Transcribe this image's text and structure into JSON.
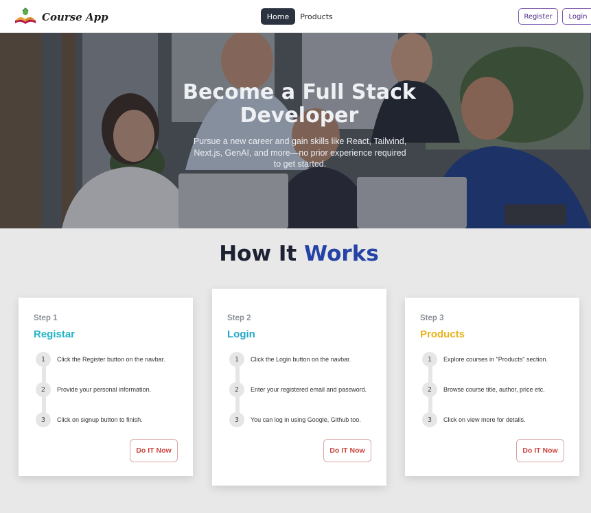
{
  "navbar": {
    "brand": "Course App",
    "links": {
      "home": "Home",
      "products": "Products"
    },
    "auth": {
      "register": "Register",
      "login": "Login"
    }
  },
  "hero": {
    "title": "Become a Full Stack Developer",
    "subtitle": "Pursue a new career and gain skills like React, Tailwind, Next.js, GenAI, and more—no prior experience required to get started."
  },
  "how_it_works": {
    "title_part1": "How It",
    "title_part2": "Works",
    "steps": [
      {
        "label": "Step 1",
        "title": "Registar",
        "items": [
          {
            "num": "1",
            "text": "Click the Register button on the navbar."
          },
          {
            "num": "2",
            "text": "Provide your personal information."
          },
          {
            "num": "3",
            "text": "Click on signup button to finish."
          }
        ],
        "button": "Do IT Now"
      },
      {
        "label": "Step 2",
        "title": "Login",
        "items": [
          {
            "num": "1",
            "text": "Click the Login button on the navbar."
          },
          {
            "num": "2",
            "text": "Enter your registered email and password."
          },
          {
            "num": "3",
            "text": "You can log in using Google, Github too."
          }
        ],
        "button": "Do IT Now"
      },
      {
        "label": "Step 3",
        "title": "Products",
        "items": [
          {
            "num": "1",
            "text": "Explore courses in \"Products\" section."
          },
          {
            "num": "2",
            "text": "Browse course title, author, price etc."
          },
          {
            "num": "3",
            "text": "Click on view more for details."
          }
        ],
        "button": "Do IT Now"
      }
    ]
  },
  "colors": {
    "nav_active_bg": "#2b3340",
    "accent_blue": "#2543a6",
    "step1_title": "#23b4c6",
    "step2_title": "#23a6c8",
    "step3_title": "#e8b21c",
    "cta_red": "#c9433f"
  },
  "icons": {
    "logo": "open-book-logo-icon"
  }
}
